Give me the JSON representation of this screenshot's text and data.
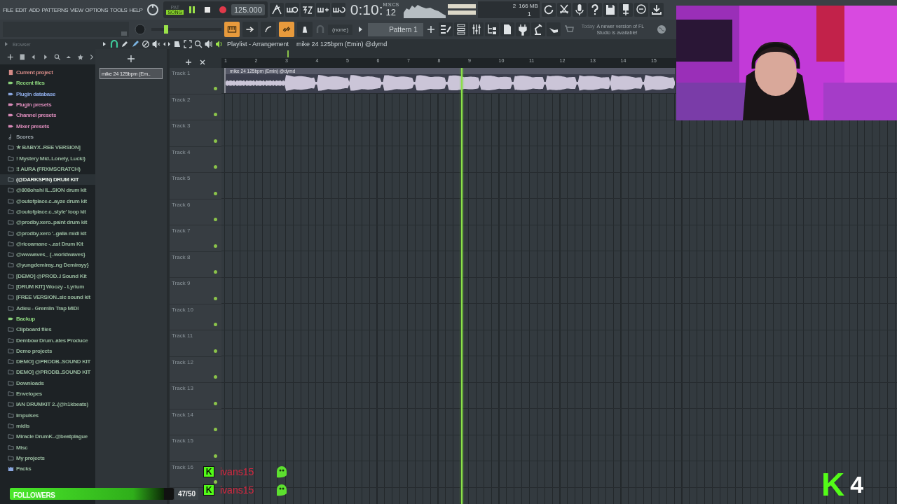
{
  "menu": [
    "FILE",
    "EDIT",
    "ADD",
    "PATTERNS",
    "VIEW",
    "OPTIONS",
    "TOOLS",
    "HELP"
  ],
  "transport": {
    "pat_label": "PAT",
    "song_label": "SONG",
    "song_mode": true,
    "playing": true,
    "tempo": "125.000"
  },
  "time": {
    "main": "0:10:",
    "sub": "12",
    "unit": "M:S:CS"
  },
  "monitor": {
    "voices": "2",
    "memory": "166 MB",
    "cpu": "1"
  },
  "pitch": {
    "level": 0.18
  },
  "toggles": [
    {
      "on": true
    },
    {
      "on": false
    },
    {
      "on": false
    },
    {
      "on": true
    },
    {
      "on": false
    }
  ],
  "channel_target": "(none)",
  "pattern": "Pattern 1",
  "hint": {
    "day": "Today",
    "text": "A newer version of FL Studio is available!"
  },
  "browser": {
    "title": "Browser",
    "items": [
      {
        "label": "Current project",
        "kind": "project",
        "selected": false
      },
      {
        "label": "Recent files",
        "kind": "recent",
        "selected": false
      },
      {
        "label": "Plugin database",
        "kind": "plugins",
        "selected": false
      },
      {
        "label": "Plugin presets",
        "kind": "presets",
        "selected": false
      },
      {
        "label": "Channel presets",
        "kind": "channel",
        "selected": false
      },
      {
        "label": "Mixer presets",
        "kind": "mixer",
        "selected": false
      },
      {
        "label": "Scores",
        "kind": "scores",
        "selected": false
      },
      {
        "label": "★ BABYX..REE VERSION]",
        "kind": "folder",
        "selected": false
      },
      {
        "label": "! Mystery Mid..Lonely, Lucki)",
        "kind": "folder",
        "selected": false
      },
      {
        "label": "!! AURA (FRXMSCRATCH)",
        "kind": "folder",
        "selected": false
      },
      {
        "label": "(@DARKSPIN) DRUM KIT",
        "kind": "folder",
        "selected": true
      },
      {
        "label": "@808ohshi IL..SION drum kit",
        "kind": "folder",
        "selected": false
      },
      {
        "label": "@outofplace.c..ayze drum kit",
        "kind": "folder",
        "selected": false
      },
      {
        "label": "@outofplace.c..style' loop kit",
        "kind": "folder",
        "selected": false
      },
      {
        "label": "@prodby.xero..paint drum kit",
        "kind": "folder",
        "selected": false
      },
      {
        "label": "@prodby.xero '..galia midi kit",
        "kind": "folder",
        "selected": false
      },
      {
        "label": "@ricoamane -..ast Drum Kit",
        "kind": "folder",
        "selected": false
      },
      {
        "label": "@wwwaves_ {..worldwaves}",
        "kind": "folder",
        "selected": false
      },
      {
        "label": "@yungdemiray..ng Demirayy}",
        "kind": "folder",
        "selected": false
      },
      {
        "label": "[DEMO] @PROD..l Sound Kit",
        "kind": "folder",
        "selected": false
      },
      {
        "label": "[DRUM KIT] Woozy - Lyrium",
        "kind": "folder",
        "selected": false
      },
      {
        "label": "[FREE VERSION..sic sound kit",
        "kind": "folder",
        "selected": false
      },
      {
        "label": "Adieu - Gremlin Trap MIDI",
        "kind": "folder",
        "selected": false
      },
      {
        "label": "Backup",
        "kind": "recent",
        "selected": false
      },
      {
        "label": "Clipboard files",
        "kind": "folder",
        "selected": false
      },
      {
        "label": "Dembow Drum..ates Produce",
        "kind": "folder",
        "selected": false
      },
      {
        "label": "Demo projects",
        "kind": "folder",
        "selected": false
      },
      {
        "label": "DEMO] @PRODB..SOUND KIT",
        "kind": "folder",
        "selected": false
      },
      {
        "label": "DEMO] @PRODB..SOUND KIT",
        "kind": "folder",
        "selected": false
      },
      {
        "label": "Downloads",
        "kind": "folder",
        "selected": false
      },
      {
        "label": "Envelopes",
        "kind": "folder",
        "selected": false
      },
      {
        "label": "IAN DRUMKIT 2..(@h1kbeats)",
        "kind": "folder",
        "selected": false
      },
      {
        "label": "Impulses",
        "kind": "folder",
        "selected": false
      },
      {
        "label": "midis",
        "kind": "folder",
        "selected": false
      },
      {
        "label": "Miracle DrumK..@beatplague",
        "kind": "folder",
        "selected": false
      },
      {
        "label": "Misc",
        "kind": "plain",
        "selected": false
      },
      {
        "label": "My projects",
        "kind": "folder",
        "selected": false
      },
      {
        "label": "Packs",
        "kind": "packs",
        "selected": false
      }
    ]
  },
  "playlist": {
    "title": "Playlist - Arrangement",
    "crumb": "mike 24 125bpm (Emin) @dymd",
    "song_position": {
      "level": 0.14
    },
    "picker": [
      "mike 24 125bpm (Em.."
    ],
    "bars": [
      "1",
      "2",
      "3",
      "4",
      "5",
      "6",
      "7",
      "8",
      "9",
      "10",
      "11",
      "12",
      "13",
      "14",
      "15"
    ],
    "playhead": {
      "level": 0.355
    },
    "clip": {
      "label": "mike 24 125bpm (Emin) @dymd"
    },
    "tracks": [
      "Track 1",
      "Track 2",
      "Track 3",
      "Track 4",
      "Track 5",
      "Track 6",
      "Track 7",
      "Track 8",
      "Track 9",
      "Track 10",
      "Track 11",
      "Track 12",
      "Track 13",
      "Track 14",
      "Track 15",
      "Track 16"
    ]
  },
  "stream": {
    "followers": {
      "label": "FOLLOWERS",
      "count": "47/50",
      "level": 0.94
    },
    "chat": [
      {
        "badge": "K",
        "user": "ivans15"
      },
      {
        "badge": "K",
        "user": "ivans15"
      }
    ],
    "logo": "K",
    "viewers": "4"
  }
}
